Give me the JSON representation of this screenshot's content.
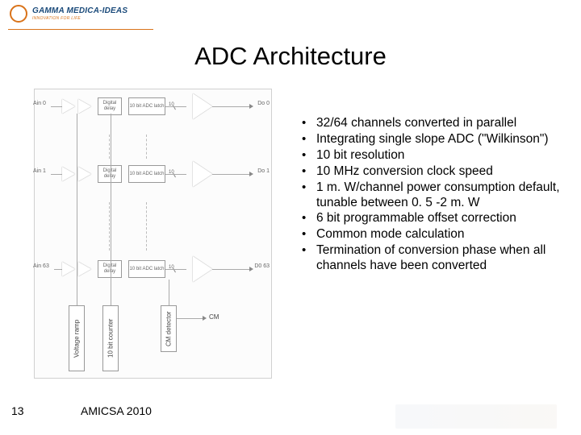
{
  "logo": {
    "brand": "GAMMA MEDICA-IDEAS",
    "tagline": "INNOVATION FOR LIFE"
  },
  "title": "ADC Architecture",
  "diagram": {
    "channels": [
      {
        "ain": "Ain 0",
        "dout": "Do 0"
      },
      {
        "ain": "Ain 1",
        "dout": "Do 1"
      },
      {
        "ain": "Ain 63",
        "dout": "D0 63"
      }
    ],
    "blocks": {
      "delay": "Digital delay",
      "latch": "10 bit ADC latch",
      "bus_width": "10",
      "ramp": "Voltage ramp",
      "counter": "10 bit counter",
      "cm_det": "CM detector",
      "cm_out": "CM"
    }
  },
  "bullets": [
    "32/64 channels converted in parallel",
    "Integrating single slope ADC (\"Wilkinson\")",
    "10 bit resolution",
    "10 MHz conversion clock speed",
    "1 m. W/channel power consumption default, tunable between 0. 5 -2 m. W",
    "6 bit programmable offset correction",
    "Common mode calculation",
    "Termination of conversion phase when all channels have been converted"
  ],
  "page_number": "13",
  "footer": "AMICSA 2010"
}
